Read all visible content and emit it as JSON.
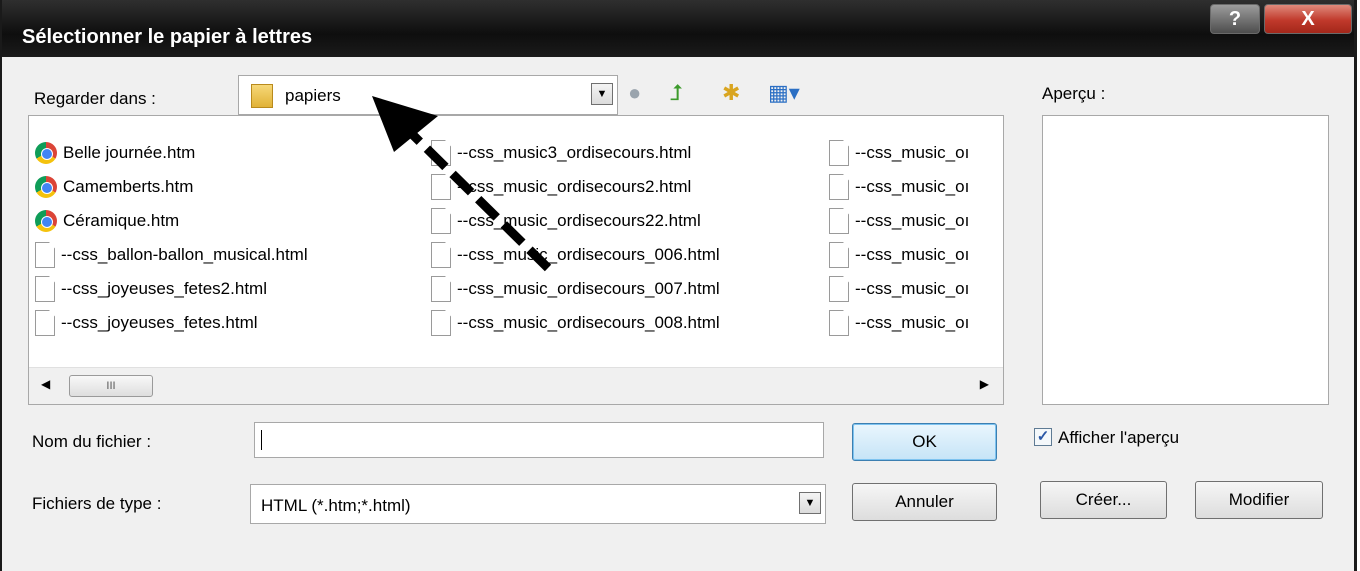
{
  "window": {
    "title": "Sélectionner le papier à lettres",
    "help_label": "?",
    "close_label": "X"
  },
  "look_in": {
    "label": "Regarder dans :",
    "value": "papiers"
  },
  "toolbar": {
    "icons": [
      "back-icon",
      "up-folder-icon",
      "new-folder-icon",
      "view-menu-icon"
    ]
  },
  "files": {
    "columns": [
      [
        {
          "name": "Belle journée.htm",
          "icon": "chrome-icon"
        },
        {
          "name": "Camemberts.htm",
          "icon": "chrome-icon"
        },
        {
          "name": "Céramique.htm",
          "icon": "chrome-icon"
        },
        {
          "name": "--css_ballon-ballon_musical.html",
          "icon": "document-icon"
        },
        {
          "name": "--css_joyeuses_fetes2.html",
          "icon": "document-icon"
        },
        {
          "name": "--css_joyeuses_fetes.html",
          "icon": "document-icon"
        }
      ],
      [
        {
          "name": "--css_music3_ordisecours.html",
          "icon": "document-icon"
        },
        {
          "name": "--css_music_ordisecours2.html",
          "icon": "document-icon"
        },
        {
          "name": "--css_music_ordisecours22.html",
          "icon": "document-icon"
        },
        {
          "name": "--css_music_ordisecours_006.html",
          "icon": "document-icon"
        },
        {
          "name": "--css_music_ordisecours_007.html",
          "icon": "document-icon"
        },
        {
          "name": "--css_music_ordisecours_008.html",
          "icon": "document-icon"
        }
      ],
      [
        {
          "name": "--css_music_oı",
          "icon": "document-icon"
        },
        {
          "name": "--css_music_oı",
          "icon": "document-icon"
        },
        {
          "name": "--css_music_oı",
          "icon": "document-icon"
        },
        {
          "name": "--css_music_oı",
          "icon": "document-icon"
        },
        {
          "name": "--css_music_oı",
          "icon": "document-icon"
        },
        {
          "name": "--css_music_oı",
          "icon": "document-icon"
        }
      ]
    ],
    "scroll_thumb": "III"
  },
  "preview": {
    "label": "Aperçu :"
  },
  "filename": {
    "label": "Nom du fichier :",
    "value": ""
  },
  "filetype": {
    "label": "Fichiers de type :",
    "value": "HTML (*.htm;*.html)"
  },
  "buttons": {
    "ok": "OK",
    "cancel": "Annuler",
    "create": "Créer...",
    "modify": "Modifier"
  },
  "show_preview": {
    "label": "Afficher l'aperçu",
    "checked": true
  }
}
